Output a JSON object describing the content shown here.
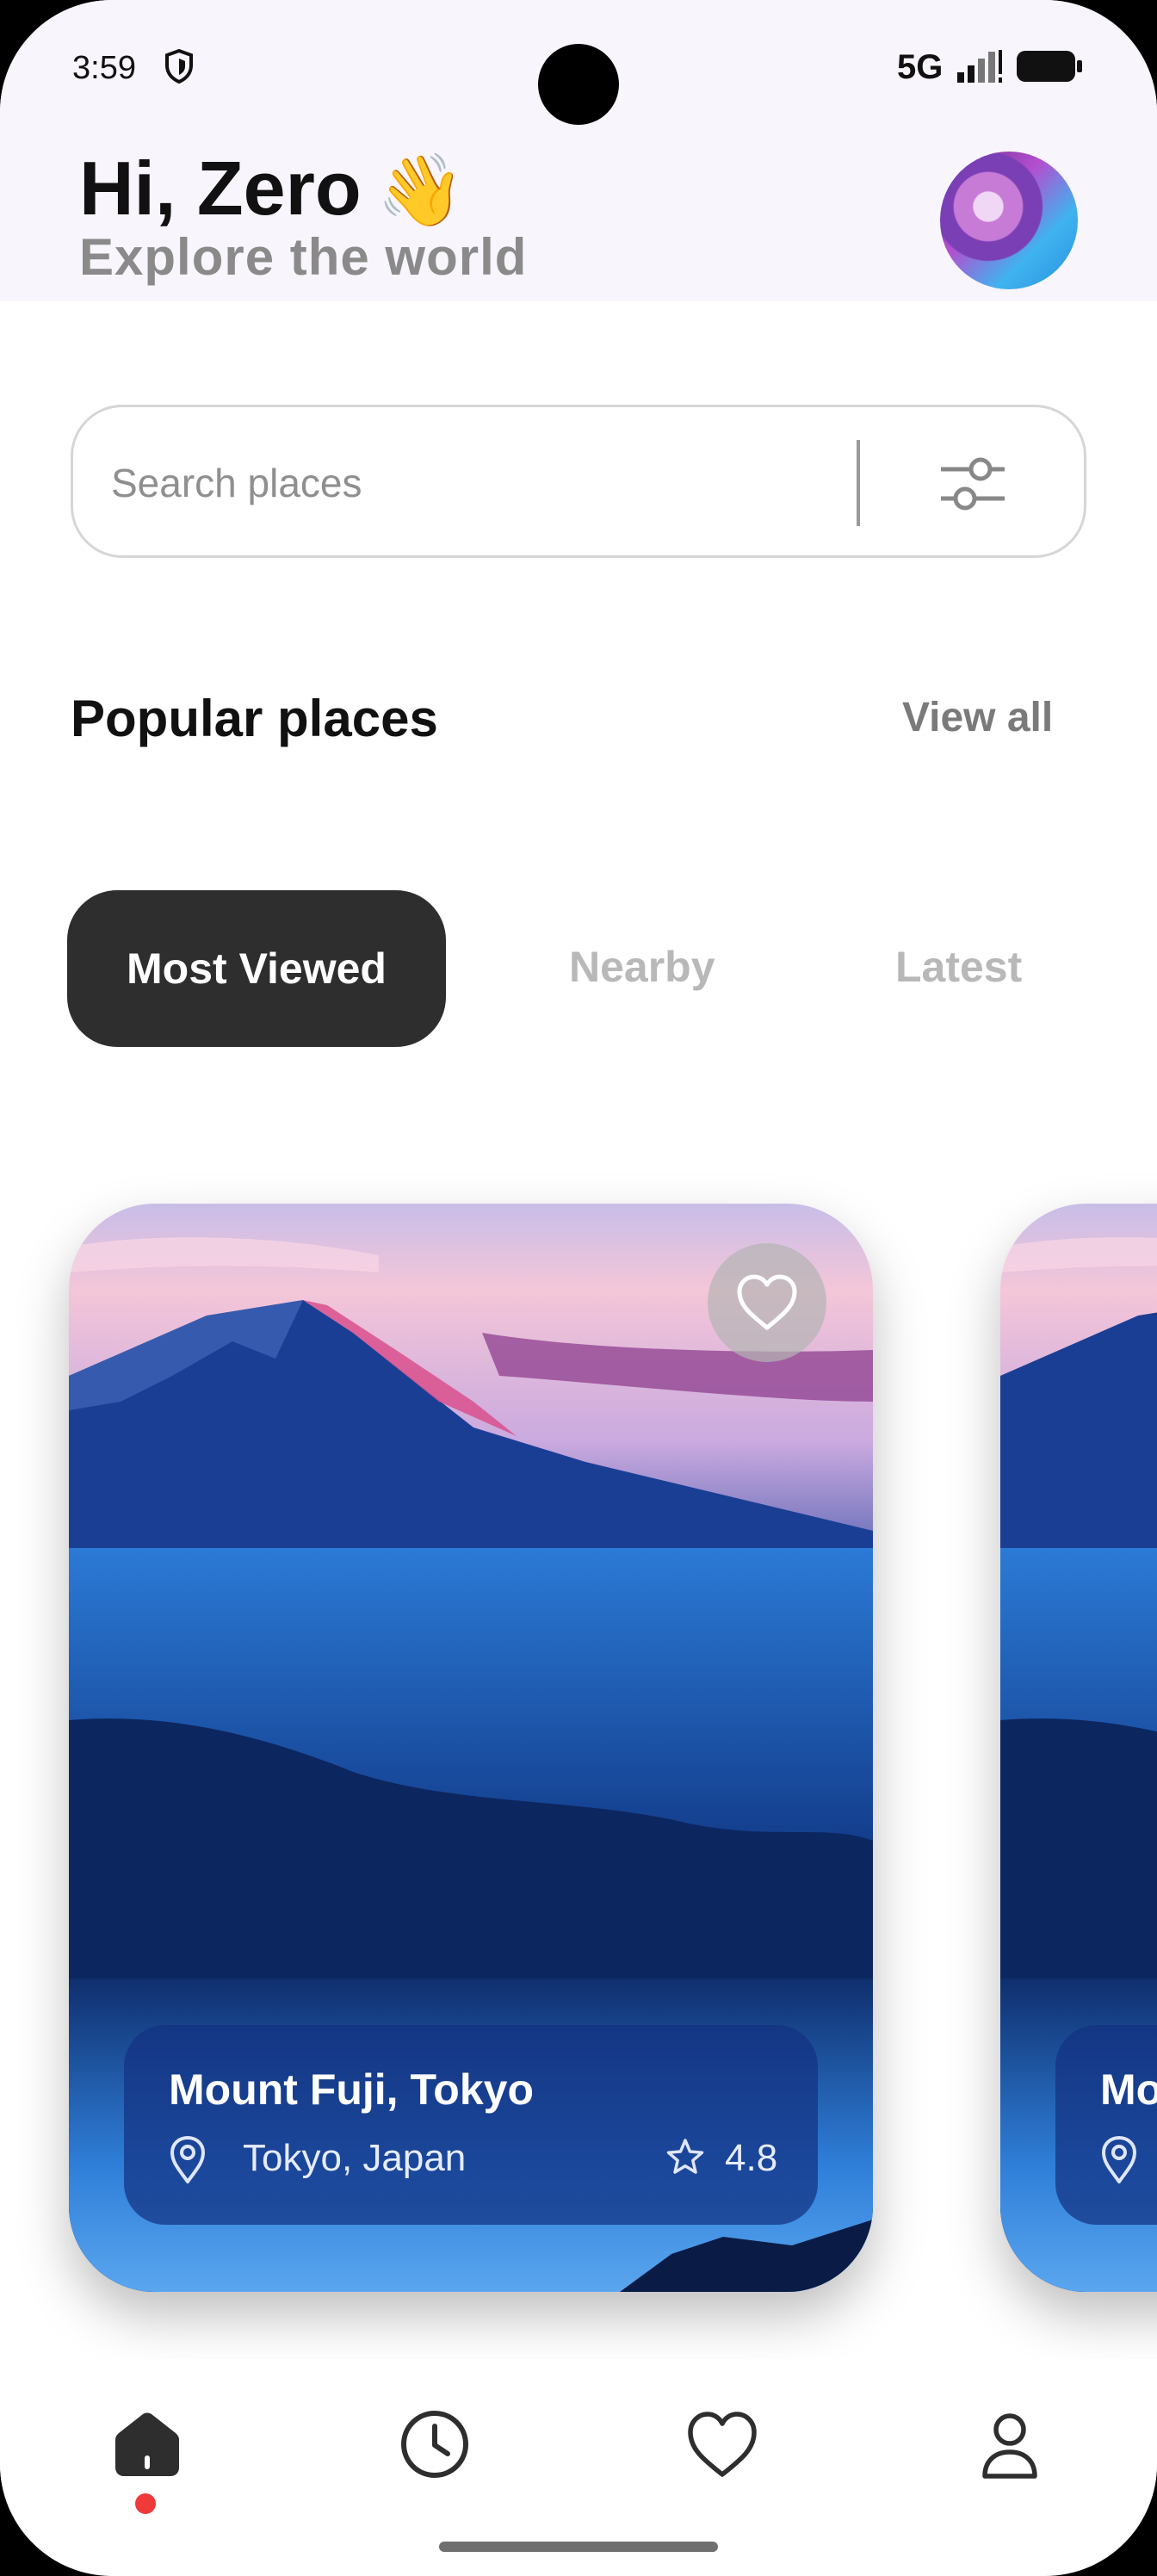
{
  "status_bar": {
    "time": "3:59",
    "network": "5G"
  },
  "header": {
    "greeting": "Hi, Zero",
    "wave_emoji": "👋",
    "subtitle": "Explore the world"
  },
  "search": {
    "placeholder": "Search places"
  },
  "section": {
    "title": "Popular places",
    "view_all": "View all"
  },
  "tabs": [
    {
      "label": "Most Viewed",
      "active": true
    },
    {
      "label": "Nearby",
      "active": false
    },
    {
      "label": "Latest",
      "active": false
    }
  ],
  "cards": [
    {
      "name": "Mount Fuji, Tokyo",
      "location": "Tokyo, Japan",
      "rating": "4.8"
    },
    {
      "name": "Mo",
      "location": ""
    }
  ],
  "nav": {
    "items": [
      "home-icon",
      "clock-icon",
      "heart-icon",
      "user-icon"
    ],
    "active": "home-icon"
  },
  "colors": {
    "accent_dark": "#2e2e2e",
    "active_dot": "#f03a3a",
    "header_bg": "#f8f5fc"
  }
}
